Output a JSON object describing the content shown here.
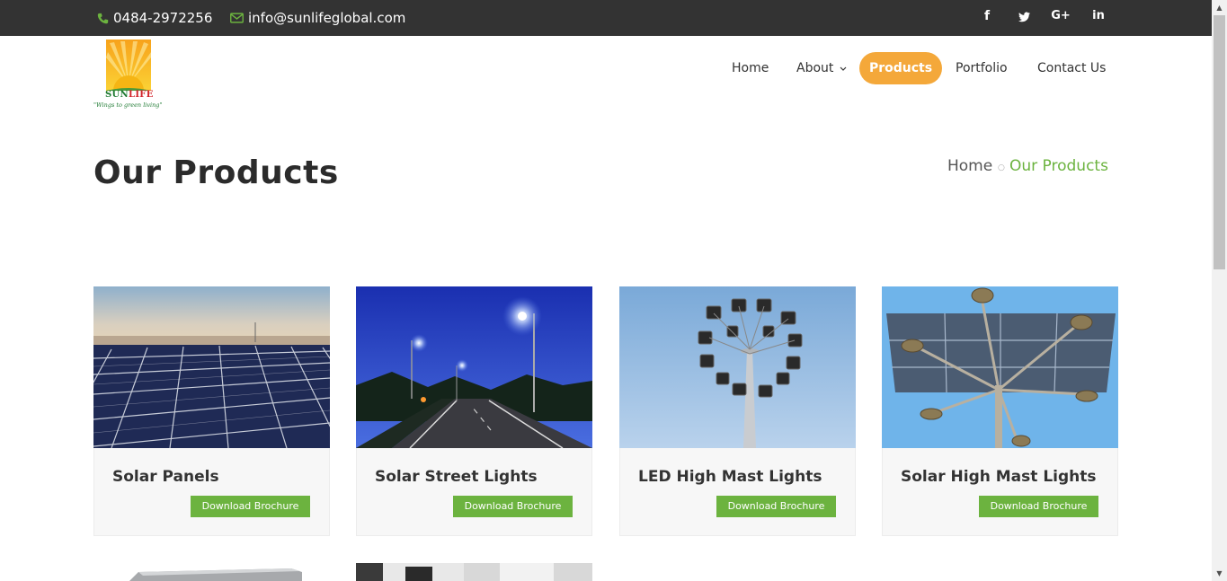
{
  "topbar": {
    "phone": "0484-2972256",
    "email": "info@sunlifeglobal.com",
    "phone_icon": "phone-icon",
    "email_icon": "envelope-icon",
    "social": [
      {
        "icon": "facebook-icon",
        "glyph": "f"
      },
      {
        "icon": "twitter-icon",
        "glyph": "t"
      },
      {
        "icon": "google-plus-icon",
        "glyph": "G+"
      },
      {
        "icon": "linkedin-icon",
        "glyph": "in"
      }
    ]
  },
  "logo": {
    "brand_part1": "SUN",
    "brand_part2": "LIFE",
    "tagline": "\"Wings to green living\""
  },
  "nav": {
    "items": [
      {
        "label": "Home"
      },
      {
        "label": "About"
      },
      {
        "label": "Products"
      },
      {
        "label": "Portfolio"
      },
      {
        "label": "Contact Us"
      }
    ],
    "about_chevron": "chevron-down-icon",
    "active": "Products"
  },
  "page": {
    "title": "Our Products",
    "breadcrumb_home": "Home",
    "breadcrumb_sep": "○",
    "breadcrumb_current": "Our Products"
  },
  "products": [
    {
      "title": "Solar Panels",
      "button": "Download Brochure"
    },
    {
      "title": "Solar Street Lights",
      "button": "Download Brochure"
    },
    {
      "title": "LED High Mast Lights",
      "button": "Download Brochure"
    },
    {
      "title": "Solar High Mast Lights",
      "button": "Download Brochure"
    }
  ],
  "colors": {
    "topbar_bg": "#333333",
    "accent_green": "#6cb33f",
    "active_nav": "#f4a83a",
    "card_bg": "#f7f7f7"
  }
}
